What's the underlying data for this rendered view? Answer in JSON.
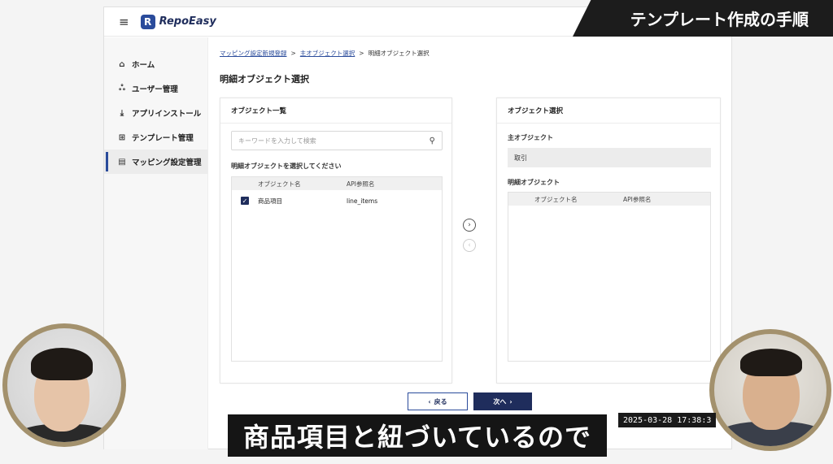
{
  "overlay": {
    "title_banner": "テンプレート作成の手順",
    "caption": "商品項目と紐づいているので",
    "timestamp": "2025-03-28  17:38:3"
  },
  "app": {
    "logo_text": "RepoEasy",
    "sidebar": {
      "items": [
        {
          "icon": "home-icon",
          "glyph": "⌂",
          "label": "ホーム",
          "active": false
        },
        {
          "icon": "users-icon",
          "glyph": "ஃ",
          "label": "ユーザー管理",
          "active": false
        },
        {
          "icon": "download-icon",
          "glyph": "⤓",
          "label": "アプリインストール",
          "active": false
        },
        {
          "icon": "template-icon",
          "glyph": "⊞",
          "label": "テンプレート管理",
          "active": false
        },
        {
          "icon": "document-icon",
          "glyph": "▤",
          "label": "マッピング設定管理",
          "active": true
        }
      ]
    },
    "breadcrumb": {
      "crumb1": "マッピング設定新規登録",
      "crumb2": "主オブジェクト選択",
      "current": "明細オブジェクト選択",
      "separator": ">"
    },
    "page_title": "明細オブジェクト選択",
    "left_panel": {
      "title": "オブジェクト一覧",
      "search_placeholder": "キーワードを入力して検索",
      "section_label": "明細オブジェクトを選択してください",
      "columns": [
        "オブジェクト名",
        "API参照名"
      ],
      "rows": [
        {
          "checked": true,
          "name": "商品項目",
          "api": "line_items"
        }
      ]
    },
    "right_panel": {
      "title": "オブジェクト選択",
      "main_label": "主オブジェクト",
      "main_value": "取引",
      "detail_label": "明細オブジェクト",
      "columns": [
        "オブジェクト名",
        "API参照名"
      ]
    },
    "buttons": {
      "back": "戻る",
      "next": "次へ"
    }
  }
}
